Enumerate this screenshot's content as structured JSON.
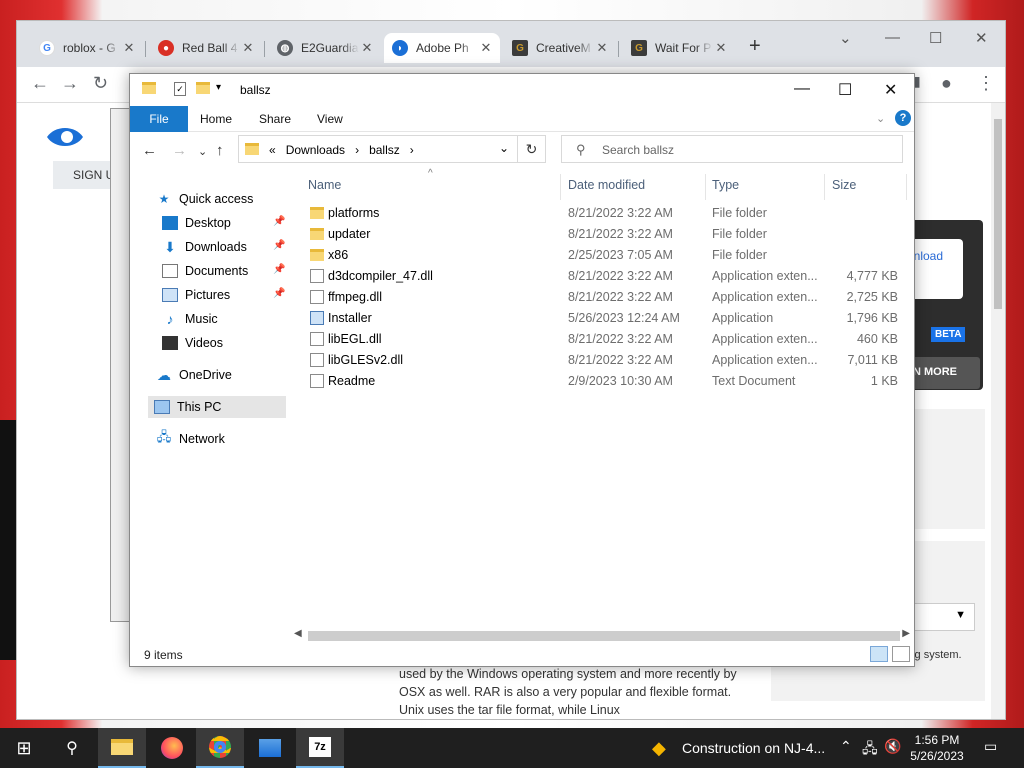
{
  "chrome": {
    "tabs": [
      {
        "title": "roblox - G",
        "icon": "google-icon",
        "color": "#4285f4"
      },
      {
        "title": "Red Ball 4",
        "icon": "redball-icon",
        "color": "#d93025"
      },
      {
        "title": "E2Guardia",
        "icon": "globe-icon",
        "color": "#5f6368"
      },
      {
        "title": "Adobe Ph",
        "icon": "adobe-icon",
        "color": "#1b6fd6"
      },
      {
        "title": "CreativeM",
        "icon": "creativem-icon",
        "color": "#c89a2e"
      },
      {
        "title": "Wait For P",
        "icon": "creativem-icon",
        "color": "#c89a2e"
      }
    ],
    "new_tab": "+",
    "page": {
      "signup": "SIGN U",
      "download": "wnload",
      "beta": "BETA",
      "learn_more": "N MORE",
      "side_small": "the selected operating system.",
      "body_text": "used by the Windows operating system and more recently by OSX as well. RAR is also a very popular and flexible format. Unix uses the tar file format, while Linux"
    }
  },
  "explorer": {
    "title": "ballsz",
    "ribbon": {
      "file": "File",
      "home": "Home",
      "share": "Share",
      "view": "View"
    },
    "address": {
      "prefix": "«",
      "parts": [
        "Downloads",
        "ballsz"
      ],
      "sep": "›"
    },
    "search_placeholder": "Search ballsz",
    "nav": [
      {
        "label": "Quick access",
        "icon": "star-icon",
        "pinned": false
      },
      {
        "label": "Desktop",
        "icon": "desktop-icon",
        "pinned": true
      },
      {
        "label": "Downloads",
        "icon": "download-icon",
        "pinned": true
      },
      {
        "label": "Documents",
        "icon": "document-icon",
        "pinned": true
      },
      {
        "label": "Pictures",
        "icon": "pictures-icon",
        "pinned": true
      },
      {
        "label": "Music",
        "icon": "music-icon",
        "pinned": false
      },
      {
        "label": "Videos",
        "icon": "videos-icon",
        "pinned": false
      },
      {
        "label": "OneDrive",
        "icon": "cloud-icon",
        "pinned": false
      },
      {
        "label": "This PC",
        "icon": "computer-icon",
        "pinned": false,
        "selected": true
      },
      {
        "label": "Network",
        "icon": "network-icon",
        "pinned": false
      }
    ],
    "columns": {
      "name": "Name",
      "date": "Date modified",
      "type": "Type",
      "size": "Size"
    },
    "files": [
      {
        "name": "platforms",
        "date": "8/21/2022 3:22 AM",
        "type": "File folder",
        "size": "",
        "kind": "folder"
      },
      {
        "name": "updater",
        "date": "8/21/2022 3:22 AM",
        "type": "File folder",
        "size": "",
        "kind": "folder"
      },
      {
        "name": "x86",
        "date": "2/25/2023 7:05 AM",
        "type": "File folder",
        "size": "",
        "kind": "folder"
      },
      {
        "name": "d3dcompiler_47.dll",
        "date": "8/21/2022 3:22 AM",
        "type": "Application exten...",
        "size": "4,777 KB",
        "kind": "dll"
      },
      {
        "name": "ffmpeg.dll",
        "date": "8/21/2022 3:22 AM",
        "type": "Application exten...",
        "size": "2,725 KB",
        "kind": "dll"
      },
      {
        "name": "Installer",
        "date": "5/26/2023 12:24 AM",
        "type": "Application",
        "size": "1,796 KB",
        "kind": "exe"
      },
      {
        "name": "libEGL.dll",
        "date": "8/21/2022 3:22 AM",
        "type": "Application exten...",
        "size": "460 KB",
        "kind": "dll"
      },
      {
        "name": "libGLESv2.dll",
        "date": "8/21/2022 3:22 AM",
        "type": "Application exten...",
        "size": "7,011 KB",
        "kind": "dll"
      },
      {
        "name": "Readme",
        "date": "2/9/2023 10:30 AM",
        "type": "Text Document",
        "size": "1 KB",
        "kind": "txt"
      }
    ],
    "status": "9 items"
  },
  "taskbar": {
    "notification": "Construction on NJ-4...",
    "time": "1:56 PM",
    "date": "5/26/2023"
  },
  "colors": {
    "accent": "#1979ca",
    "taskbar": "#1f1f1f",
    "selection": "#e5e5e5"
  }
}
